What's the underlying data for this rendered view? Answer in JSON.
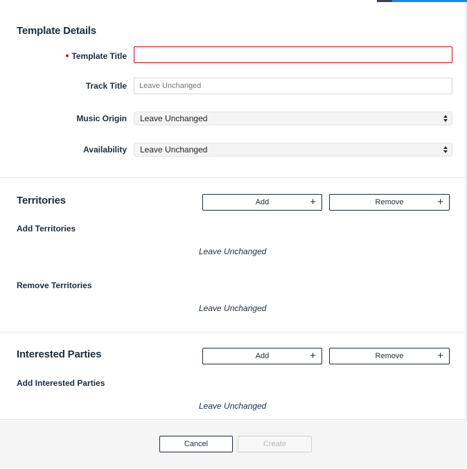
{
  "template_details": {
    "heading": "Template Details",
    "template_title": {
      "label": "Template Title",
      "value": "",
      "placeholder": ""
    },
    "track_title": {
      "label": "Track Title",
      "placeholder": "Leave Unchanged"
    },
    "music_origin": {
      "label": "Music Origin",
      "selected": "Leave Unchanged"
    },
    "availability": {
      "label": "Availability",
      "selected": "Leave Unchanged"
    }
  },
  "territories": {
    "heading": "Territories",
    "add_label": "Add",
    "remove_label": "Remove",
    "add_sublabel": "Add Territories",
    "add_value": "Leave Unchanged",
    "remove_sublabel": "Remove Territories",
    "remove_value": "Leave Unchanged"
  },
  "interested_parties": {
    "heading": "Interested Parties",
    "add_label": "Add",
    "remove_label": "Remove",
    "add_sublabel": "Add Interested Parties",
    "add_value": "Leave Unchanged"
  },
  "footer": {
    "cancel_label": "Cancel",
    "create_label": "Create"
  },
  "icons": {
    "plus": "+",
    "required_dot": "•"
  },
  "colors": {
    "required": "#d0021b",
    "text": "#1d2b3a",
    "accent": "#1e88e5"
  }
}
